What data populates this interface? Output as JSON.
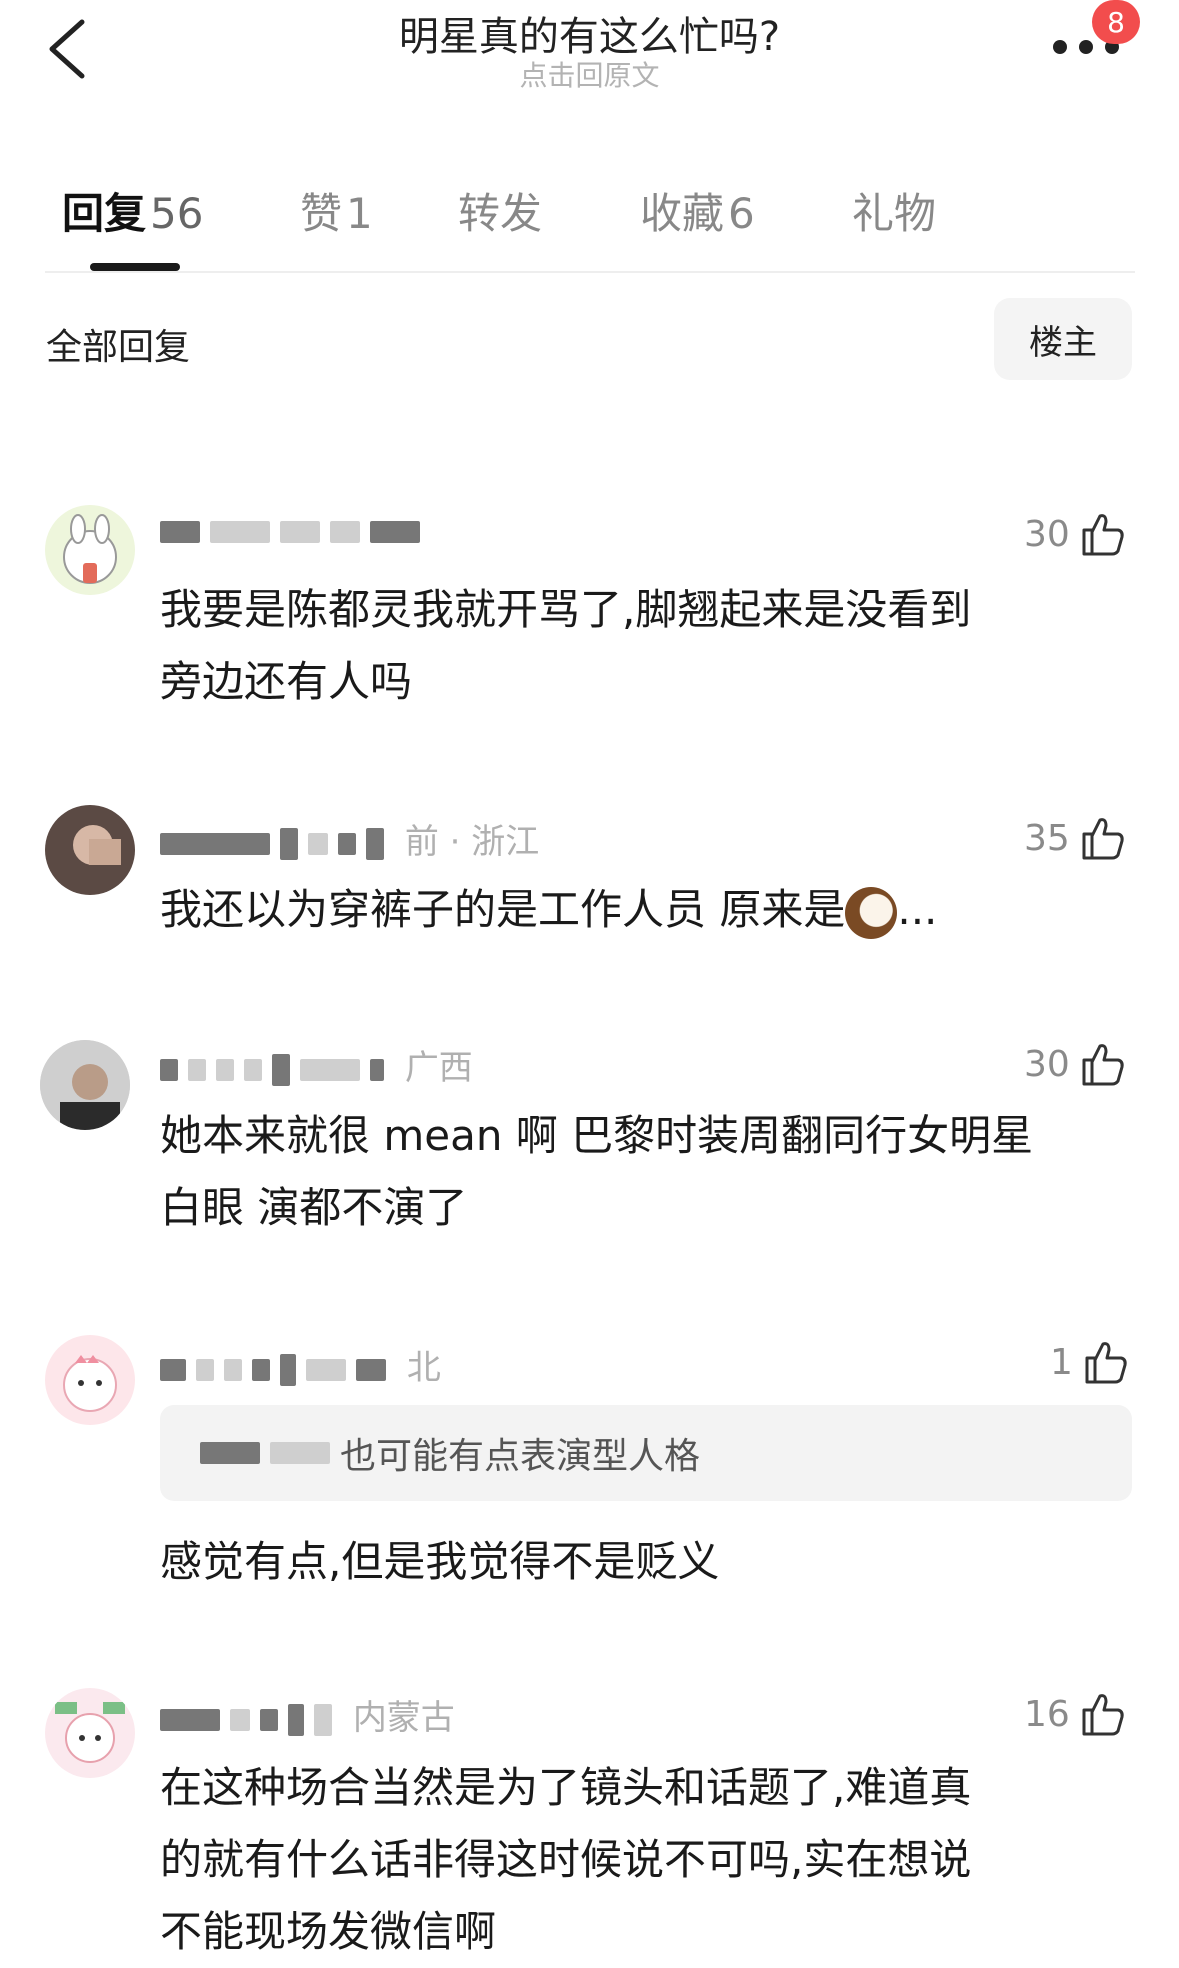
{
  "header": {
    "title": "明星真的有这么忙吗?",
    "subtitle": "点击回原文",
    "notification_count": "8"
  },
  "tabs": [
    {
      "label": "回复",
      "count": "56"
    },
    {
      "label": "赞",
      "count": "1"
    },
    {
      "label": "转发",
      "count": ""
    },
    {
      "label": "收藏",
      "count": "6"
    },
    {
      "label": "礼物",
      "count": ""
    }
  ],
  "filter": {
    "label": "全部回复",
    "button": "楼主"
  },
  "comments": [
    {
      "meta": "",
      "likes": "30",
      "text_lines": [
        "我要是陈都灵我就开骂了,脚翘起来是没看到",
        "旁边还有人吗"
      ]
    },
    {
      "meta": "前 · 浙江",
      "likes": "35",
      "text": "我还以为穿裤子的是工作人员 原来是",
      "text_tail": "..."
    },
    {
      "meta": "广西",
      "likes": "30",
      "text_lines": [
        "她本来就很 mean 啊 巴黎时装周翻同行女明星",
        "白眼 演都不演了"
      ]
    },
    {
      "meta": "北",
      "likes": "1",
      "quote": "也可能有点表演型人格",
      "text": "感觉有点,但是我觉得不是贬义"
    },
    {
      "meta": "内蒙古",
      "likes": "16",
      "text_lines": [
        "在这种场合当然是为了镜头和话题了,难道真",
        "的就有什么话非得这时候说不可吗,实在想说",
        "不能现场发微信啊"
      ]
    }
  ],
  "icons": [
    "back-chevron-icon",
    "more-dots-icon",
    "thumbs-up-icon",
    "coconut-emoji-icon"
  ],
  "colors": {
    "badge": "#f24d4d",
    "active_tab": "#111111",
    "muted": "#888888"
  }
}
